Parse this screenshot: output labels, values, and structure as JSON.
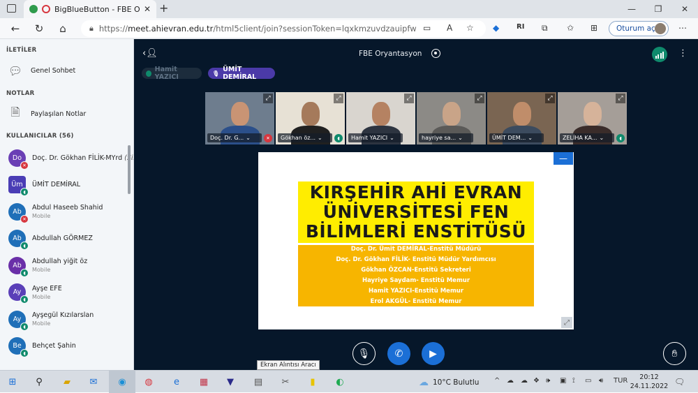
{
  "browser": {
    "tab_title": "BigBlueButton - FBE Oryantasyon",
    "url_scheme": "https://",
    "url_host": "meet.ahievran.edu.tr",
    "url_path": "/html5client/join?sessionToken=lqxkmzuvdzauipfw",
    "profile_label": "Oturum aç",
    "toolbar_badge": "R"
  },
  "sidebar": {
    "messages_title": "İLETİLER",
    "public_chat": "Genel Sohbet",
    "notes_title": "NOTLAR",
    "shared_notes": "Paylaşılan Notlar",
    "users_title": "KULLANICILAR (56)",
    "users": [
      {
        "initials": "Do",
        "name": "Doç. Dr. Gökhan FİLİK-MYrd",
        "self_tag": "(Siz)",
        "sub": "",
        "color": "#6a3fb5",
        "badge": "red",
        "square": false
      },
      {
        "initials": "Üm",
        "name": "ÜMİT DEMİRAL",
        "self_tag": "",
        "sub": "",
        "color": "#4a3db5",
        "badge": "green",
        "square": true
      },
      {
        "initials": "Ab",
        "name": "Abdul Haseeb Shahid",
        "self_tag": "",
        "sub": "Mobile",
        "color": "#1f6fb8",
        "badge": "red",
        "square": false
      },
      {
        "initials": "Ab",
        "name": "Abdullah GÖRMEZ",
        "self_tag": "",
        "sub": "",
        "color": "#1f6fb8",
        "badge": "green",
        "square": false
      },
      {
        "initials": "Ab",
        "name": "Abdullah yiğit öz",
        "self_tag": "",
        "sub": "Mobile",
        "color": "#6a2fa8",
        "badge": "green",
        "square": false
      },
      {
        "initials": "Ay",
        "name": "Ayşe EFE",
        "self_tag": "",
        "sub": "Mobile",
        "color": "#5a3fb8",
        "badge": "green",
        "square": false
      },
      {
        "initials": "Ay",
        "name": "Ayşegül Kızılarslan",
        "self_tag": "",
        "sub": "Mobile",
        "color": "#1f6fb8",
        "badge": "green",
        "square": false
      },
      {
        "initials": "Be",
        "name": "Behçet Şahin",
        "self_tag": "",
        "sub": "",
        "color": "#1f6fb8",
        "badge": "green",
        "square": false
      }
    ]
  },
  "meeting": {
    "title": "FBE Oryantasyon",
    "talkers": [
      "Hamit YAZICI",
      "ÜMİT DEMİRAL"
    ]
  },
  "videos": [
    {
      "label": "Doç. Dr. G...",
      "status": "red",
      "bg": "#6e7d8e",
      "skin": "#c99474",
      "shirt": "#2b4f8a"
    },
    {
      "label": "Gökhan öz...",
      "status": "green",
      "bg": "#e7e1d5",
      "skin": "#a57a5b",
      "shirt": "#202020"
    },
    {
      "label": "Hamit YAZICI",
      "status": "",
      "bg": "#d9d5cf",
      "skin": "#b58262",
      "shirt": "#2d3440"
    },
    {
      "label": "hayriye sa...",
      "status": "",
      "bg": "#8c8a86",
      "skin": "#c9a488",
      "shirt": "#5b5a58"
    },
    {
      "label": "ÜMİT DEM...",
      "status": "",
      "bg": "#7a6552",
      "skin": "#c08d6a",
      "shirt": "#3c4b5e"
    },
    {
      "label": "ZELİHA KA...",
      "status": "green",
      "bg": "#a59e98",
      "skin": "#d6b39a",
      "shirt": "#3a2c2a"
    }
  ],
  "slide": {
    "title_lines": [
      "KIRŞEHİR AHİ EVRAN",
      "ÜNİVERSİTESİ FEN",
      "BİLİMLERİ ENSTİTÜSÜ"
    ],
    "staff": [
      "Doç. Dr. Ümit DEMİRAL-Enstitü Müdürü",
      "Doç. Dr. Gökhan FİLİK- Enstitü Müdür Yardımcısı",
      "Gökhan ÖZCAN-Enstitü Sekreteri",
      "Hayriye Saydam- Enstitü Memur",
      "Hamit YAZICI-Enstitü Memur",
      "Erol AKGÜL- Enstitü Memur"
    ]
  },
  "taskbar": {
    "tooltip": "Ekran Alıntısı Aracı",
    "weather": "10°C  Bulutlu",
    "lang": "TUR",
    "time": "20:12",
    "date": "24.11.2022"
  },
  "colors": {
    "main_bg": "#06172a",
    "accent_blue": "#1b6fd6",
    "slide_yellow": "#ffed00",
    "slide_orange": "#f7b500"
  }
}
